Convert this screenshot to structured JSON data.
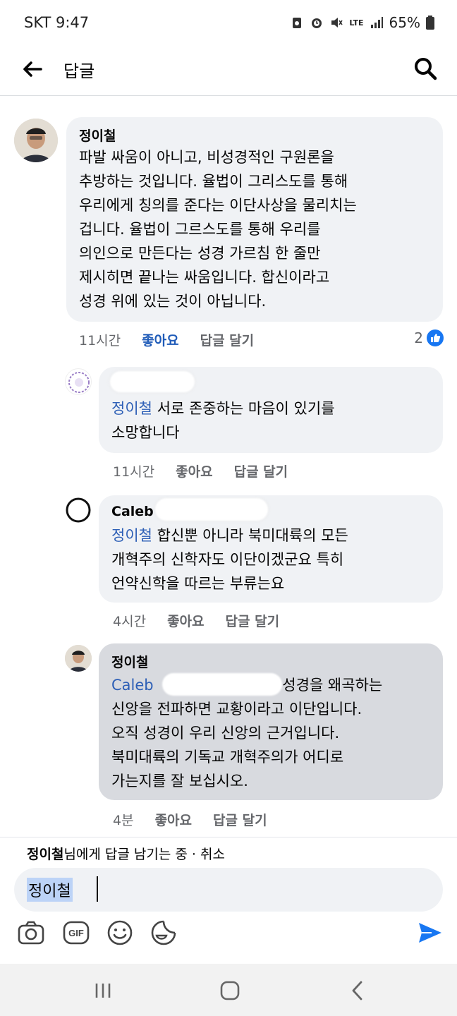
{
  "status_bar": {
    "carrier_time": "SKT 9:47",
    "network": "LTE",
    "battery": "65%"
  },
  "header": {
    "title": "답글"
  },
  "comments": [
    {
      "author": "정이철",
      "text": "파발 싸움이 아니고, 비성경적인 구원론을\n추방하는 것입니다. 율법이 그리스도를 통해\n우리에게 칭의를 준다는 이단사상을 물리치는\n겁니다. 율법이 그르스도를 통해 우리를\n의인으로 만든다는 성경 가르침 한 줄만\n제시히면 끝나는 싸움입니다. 합신이라고\n성경 위에 있는 것이 아닙니다.",
      "time": "11시간",
      "like": "좋아요",
      "reply": "답글 달기",
      "reactions": "2"
    },
    {
      "mention": "정이철",
      "text_first": " 서로 존중하는 마음이 있기를",
      "text_rest": "소망합니다",
      "time": "11시간",
      "like": "좋아요",
      "reply": "답글 달기"
    },
    {
      "author": "Caleb",
      "mention": "정이철",
      "text_first": " 합신뿐 아니라 북미대륙의 모든",
      "text_rest": "개혁주의 신학자도 이단이겠군요 특히\n언약신학을 따르는 부류는요",
      "time": "4시간",
      "like": "좋아요",
      "reply": "답글 달기"
    },
    {
      "author": "정이철",
      "mention": "Caleb",
      "text_first": " 성경을 왜곡하는",
      "text_rest": "신앙을 전파하면 교황이라고 이단입니다.\n오직 성경이 우리 신앙의 근거입니다.\n북미대륙의 기독교 개혁주의가 어디로\n가는지를 잘 보십시오.",
      "time": "4분",
      "like": "좋아요",
      "reply": "답글 달기"
    }
  ],
  "reply_bar": {
    "replying_name": "정이철",
    "replying_suffix": "님에게 답글 남기는 중 · 취소",
    "input_mention": "정이철"
  },
  "toolbar_icons": [
    "camera-icon",
    "gif-icon",
    "emoji-icon",
    "sticker-icon",
    "send-icon"
  ],
  "nav_icons": [
    "recent-apps-icon",
    "home-icon",
    "back-nav-icon"
  ],
  "colors": {
    "accent": "#1877f2",
    "mention": "#2d5fb6",
    "bubble": "#f0f2f5",
    "bubble_highlight": "#d8dadf"
  }
}
